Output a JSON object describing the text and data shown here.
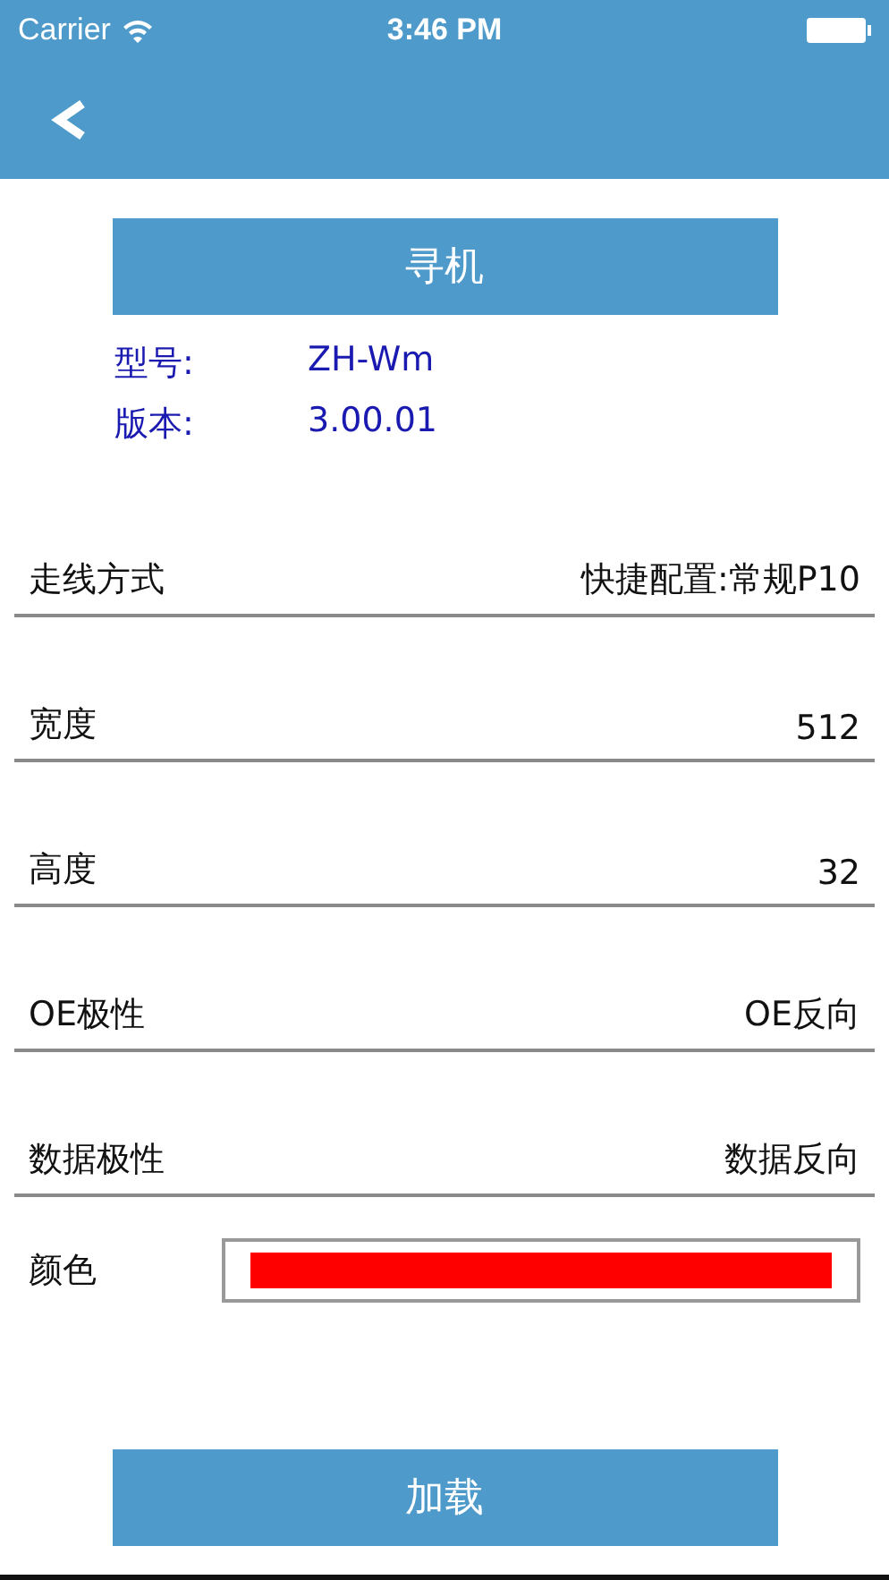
{
  "status_bar": {
    "carrier": "Carrier",
    "time": "3:46 PM"
  },
  "search_button": {
    "label": "寻机"
  },
  "device_info": [
    {
      "label": "型号:",
      "value": "ZH-Wm"
    },
    {
      "label": "版本:",
      "value": "3.00.01"
    }
  ],
  "settings": [
    {
      "kind": "value",
      "label": "走线方式",
      "value": "快捷配置:常规P10"
    },
    {
      "kind": "value",
      "label": "宽度",
      "value": "512"
    },
    {
      "kind": "value",
      "label": "高度",
      "value": "32"
    },
    {
      "kind": "value",
      "label": "OE极性",
      "value": "OE反向"
    },
    {
      "kind": "value",
      "label": "数据极性",
      "value": "数据反向"
    },
    {
      "kind": "color",
      "label": "颜色",
      "color": "#ff0000"
    }
  ],
  "load_button": {
    "label": "加载"
  }
}
